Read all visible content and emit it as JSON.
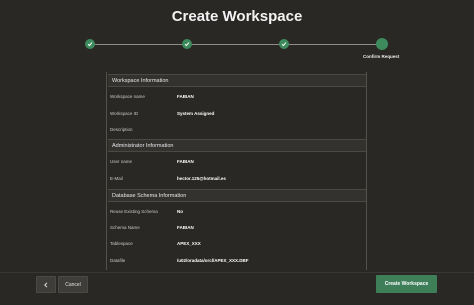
{
  "page": {
    "title": "Create Workspace"
  },
  "train": {
    "current_step_label": "Confirm Request",
    "colors": {
      "completed": "#3d8b5d",
      "current": "#3d8b5d"
    }
  },
  "sections": {
    "workspace": {
      "header": "Workspace Information",
      "rows": [
        {
          "label": "Workspace name",
          "value": "FABIAN"
        },
        {
          "label": "Workspace ID",
          "value": "System Assigned"
        },
        {
          "label": "Description",
          "value": ""
        }
      ]
    },
    "admin": {
      "header": "Administrator Information",
      "rows": [
        {
          "label": "User name",
          "value": "FABIAN"
        },
        {
          "label": "E-Mail",
          "value": "hector.125@hotmail.es"
        }
      ]
    },
    "schema": {
      "header": "Database Schema Information",
      "rows": [
        {
          "label": "Reuse Existing Schema",
          "value": "No"
        },
        {
          "label": "Schema Name",
          "value": "FABIAN"
        },
        {
          "label": "Tablespace",
          "value": "APEX_XXX"
        },
        {
          "label": "Datafile",
          "value": "/u02/oradata/orcl/APEX_XXX.DBF"
        }
      ]
    }
  },
  "buttons": {
    "back_icon": "chevron-left-icon",
    "cancel": "Cancel",
    "create": "Create Workspace"
  },
  "colors": {
    "background": "#2a2825",
    "accent": "#3e7f59"
  }
}
